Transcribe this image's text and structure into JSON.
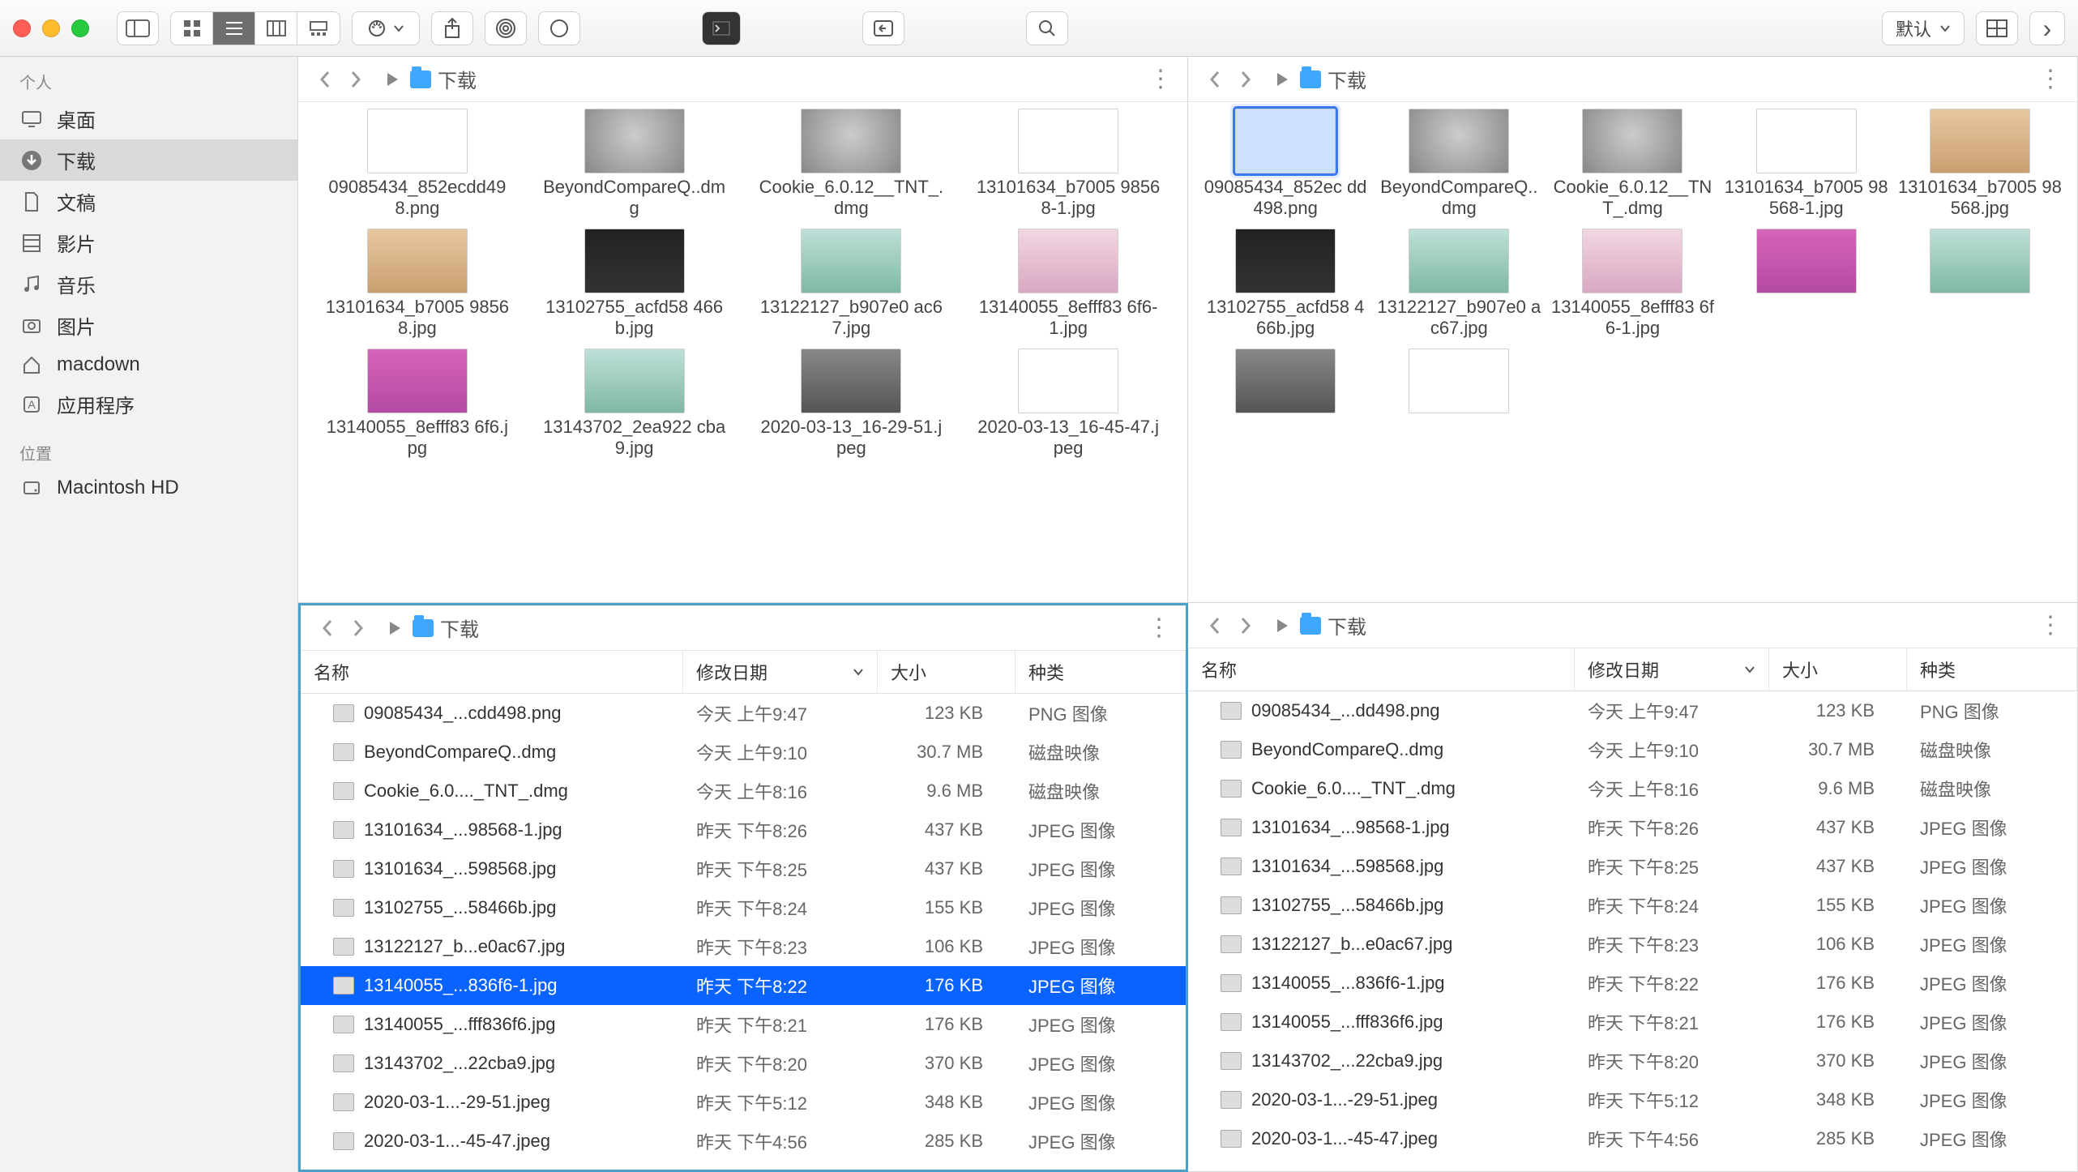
{
  "toolbar": {
    "default_label": "默认"
  },
  "sidebar": {
    "personal_header": "个人",
    "location_header": "位置",
    "items": [
      {
        "icon": "desktop",
        "label": "桌面"
      },
      {
        "icon": "download",
        "label": "下载",
        "active": true
      },
      {
        "icon": "doc",
        "label": "文稿"
      },
      {
        "icon": "film",
        "label": "影片"
      },
      {
        "icon": "music",
        "label": "音乐"
      },
      {
        "icon": "photo",
        "label": "图片"
      },
      {
        "icon": "home",
        "label": "macdown"
      },
      {
        "icon": "app",
        "label": "应用程序"
      }
    ],
    "locations": [
      {
        "icon": "hd",
        "label": "Macintosh HD"
      }
    ]
  },
  "pathbar": {
    "folder": "下载"
  },
  "columns": {
    "name": "名称",
    "date": "修改日期",
    "size": "大小",
    "kind": "种类"
  },
  "grid_left": [
    {
      "t": "th-png",
      "n": "09085434_852ecdd498.png"
    },
    {
      "t": "th-drive",
      "n": "BeyondCompareQ..dmg"
    },
    {
      "t": "th-drive",
      "n": "Cookie_6.0.12__TNT_.dmg"
    },
    {
      "t": "th-png",
      "n": "13101634_b7005 98568-1.jpg"
    },
    {
      "t": "th-desk1",
      "n": "13101634_b7005 98568.jpg"
    },
    {
      "t": "th-dark",
      "n": "13102755_acfd58 466b.jpg"
    },
    {
      "t": "th-desk2",
      "n": "13122127_b907e0 ac67.jpg"
    },
    {
      "t": "th-desk3",
      "n": "13140055_8efff83 6f6-1.jpg"
    },
    {
      "t": "th-pink",
      "n": "13140055_8efff83 6f6.jpg"
    },
    {
      "t": "th-desk2",
      "n": "13143702_2ea922 cba9.jpg"
    },
    {
      "t": "th-city",
      "n": "2020-03-13_16-29-51.jpeg"
    },
    {
      "t": "th-viral",
      "n": "2020-03-13_16-45-47.jpeg"
    }
  ],
  "grid_right": [
    {
      "t": "th-blue",
      "n": "09085434_852ec dd498.png",
      "sel": true
    },
    {
      "t": "th-drive",
      "n": "BeyondCompareQ..dmg"
    },
    {
      "t": "th-drive",
      "n": "Cookie_6.0.12__TNT_.dmg"
    },
    {
      "t": "th-png",
      "n": "13101634_b7005 98568-1.jpg"
    },
    {
      "t": "th-desk1",
      "n": "13101634_b7005 98568.jpg"
    },
    {
      "t": "th-dark",
      "n": "13102755_acfd58 466b.jpg"
    },
    {
      "t": "th-desk2",
      "n": "13122127_b907e0 ac67.jpg"
    },
    {
      "t": "th-desk3",
      "n": "13140055_8efff83 6f6-1.jpg"
    },
    {
      "t": "th-pink",
      "n": ""
    },
    {
      "t": "th-desk2",
      "n": ""
    },
    {
      "t": "th-city",
      "n": ""
    },
    {
      "t": "th-viral",
      "n": ""
    }
  ],
  "list_left": [
    {
      "n": "09085434_...cdd498.png",
      "d": "今天 上午9:47",
      "s": "123 KB",
      "k": "PNG 图像"
    },
    {
      "n": "BeyondCompareQ..dmg",
      "d": "今天 上午9:10",
      "s": "30.7 MB",
      "k": "磁盘映像"
    },
    {
      "n": "Cookie_6.0...._TNT_.dmg",
      "d": "今天 上午8:16",
      "s": "9.6 MB",
      "k": "磁盘映像"
    },
    {
      "n": "13101634_...98568-1.jpg",
      "d": "昨天 下午8:26",
      "s": "437 KB",
      "k": "JPEG 图像"
    },
    {
      "n": "13101634_...598568.jpg",
      "d": "昨天 下午8:25",
      "s": "437 KB",
      "k": "JPEG 图像"
    },
    {
      "n": "13102755_...58466b.jpg",
      "d": "昨天 下午8:24",
      "s": "155 KB",
      "k": "JPEG 图像"
    },
    {
      "n": "13122127_b...e0ac67.jpg",
      "d": "昨天 下午8:23",
      "s": "106 KB",
      "k": "JPEG 图像"
    },
    {
      "n": "13140055_...836f6-1.jpg",
      "d": "昨天 下午8:22",
      "s": "176 KB",
      "k": "JPEG 图像",
      "sel": true
    },
    {
      "n": "13140055_...fff836f6.jpg",
      "d": "昨天 下午8:21",
      "s": "176 KB",
      "k": "JPEG 图像"
    },
    {
      "n": "13143702_...22cba9.jpg",
      "d": "昨天 下午8:20",
      "s": "370 KB",
      "k": "JPEG 图像"
    },
    {
      "n": "2020-03-1...-29-51.jpeg",
      "d": "昨天 下午5:12",
      "s": "348 KB",
      "k": "JPEG 图像"
    },
    {
      "n": "2020-03-1...-45-47.jpeg",
      "d": "昨天 下午4:56",
      "s": "285 KB",
      "k": "JPEG 图像"
    }
  ],
  "list_right": [
    {
      "n": "09085434_...dd498.png",
      "d": "今天 上午9:47",
      "s": "123 KB",
      "k": "PNG 图像"
    },
    {
      "n": "BeyondCompareQ..dmg",
      "d": "今天 上午9:10",
      "s": "30.7 MB",
      "k": "磁盘映像"
    },
    {
      "n": "Cookie_6.0...._TNT_.dmg",
      "d": "今天 上午8:16",
      "s": "9.6 MB",
      "k": "磁盘映像"
    },
    {
      "n": "13101634_...98568-1.jpg",
      "d": "昨天 下午8:26",
      "s": "437 KB",
      "k": "JPEG 图像"
    },
    {
      "n": "13101634_...598568.jpg",
      "d": "昨天 下午8:25",
      "s": "437 KB",
      "k": "JPEG 图像"
    },
    {
      "n": "13102755_...58466b.jpg",
      "d": "昨天 下午8:24",
      "s": "155 KB",
      "k": "JPEG 图像"
    },
    {
      "n": "13122127_b...e0ac67.jpg",
      "d": "昨天 下午8:23",
      "s": "106 KB",
      "k": "JPEG 图像"
    },
    {
      "n": "13140055_...836f6-1.jpg",
      "d": "昨天 下午8:22",
      "s": "176 KB",
      "k": "JPEG 图像"
    },
    {
      "n": "13140055_...fff836f6.jpg",
      "d": "昨天 下午8:21",
      "s": "176 KB",
      "k": "JPEG 图像"
    },
    {
      "n": "13143702_...22cba9.jpg",
      "d": "昨天 下午8:20",
      "s": "370 KB",
      "k": "JPEG 图像"
    },
    {
      "n": "2020-03-1...-29-51.jpeg",
      "d": "昨天 下午5:12",
      "s": "348 KB",
      "k": "JPEG 图像"
    },
    {
      "n": "2020-03-1...-45-47.jpeg",
      "d": "昨天 下午4:56",
      "s": "285 KB",
      "k": "JPEG 图像"
    }
  ]
}
